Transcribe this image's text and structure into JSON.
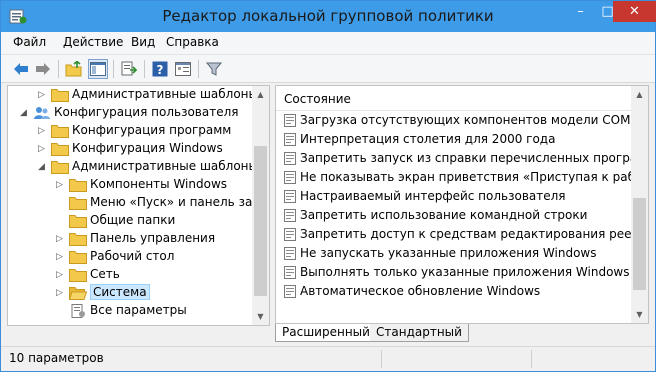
{
  "window": {
    "title": "Редактор локальной групповой политики",
    "controls": {
      "minimize": "–",
      "maximize": "□",
      "close": "✕"
    }
  },
  "menu": {
    "items": [
      {
        "label": "Файл"
      },
      {
        "label": "Действие"
      },
      {
        "label": "Вид"
      },
      {
        "label": "Справка"
      }
    ]
  },
  "toolbar": {
    "buttons": [
      {
        "icon": "back-arrow-icon"
      },
      {
        "icon": "forward-arrow-icon"
      },
      {
        "icon": "up-folder-icon"
      },
      {
        "icon": "show-hide-tree-icon"
      },
      {
        "icon": "export-list-icon"
      },
      {
        "icon": "help-icon"
      },
      {
        "icon": "properties-view-icon"
      },
      {
        "icon": "filter-icon"
      }
    ]
  },
  "tree": {
    "items": [
      {
        "label": "Административные шаблоны",
        "toggle": "▷"
      },
      {
        "label": "Конфигурация пользователя",
        "toggle": "◢"
      },
      {
        "label": "Конфигурация программ",
        "toggle": "▷"
      },
      {
        "label": "Конфигурация Windows",
        "toggle": "▷"
      },
      {
        "label": "Административные шаблоны",
        "toggle": "◢"
      },
      {
        "label": "Компоненты Windows",
        "toggle": "▷"
      },
      {
        "label": "Меню «Пуск» и панель задач",
        "toggle": ""
      },
      {
        "label": "Общие папки",
        "toggle": ""
      },
      {
        "label": "Панель управления",
        "toggle": "▷"
      },
      {
        "label": "Рабочий стол",
        "toggle": "▷"
      },
      {
        "label": "Сеть",
        "toggle": "▷"
      },
      {
        "label": "Система",
        "toggle": "▷"
      },
      {
        "label": "Все параметры",
        "toggle": ""
      }
    ]
  },
  "list": {
    "column_header": "Состояние",
    "items": [
      {
        "label": "Загрузка отсутствующих компонентов модели COM"
      },
      {
        "label": "Интерпретация столетия для 2000 года"
      },
      {
        "label": "Запретить запуск из справки перечисленных программ"
      },
      {
        "label": "Не показывать экран приветствия «Приступая к работе» при входе в систему"
      },
      {
        "label": "Настраиваемый интерфейс пользователя"
      },
      {
        "label": "Запретить использование командной строки"
      },
      {
        "label": "Запретить доступ к средствам редактирования реестра"
      },
      {
        "label": "Не запускать указанные приложения Windows"
      },
      {
        "label": "Выполнять только указанные приложения Windows"
      },
      {
        "label": "Автоматическое обновление Windows"
      }
    ]
  },
  "tabs": {
    "extended": "Расширенный",
    "standard": "Стандартный"
  },
  "status": {
    "text": "10 параметров"
  },
  "colors": {
    "titlebar": "#3e9be8",
    "close_button": "#c7372f",
    "folder": "#f3c94b",
    "selection": "#cce8ff"
  }
}
